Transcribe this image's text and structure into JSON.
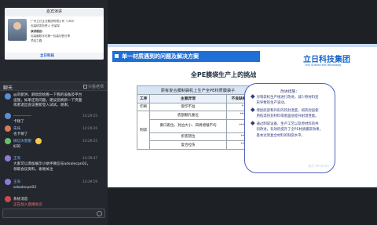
{
  "speaker": {
    "banner": "嘉宾演讲",
    "lines": [
      "广州立日企业集团有限公司（LRD）",
      "包装研发负责人 许留军",
      "演讲题目：",
      "包装膜数字化第一包装切割分享",
      "项目之路"
    ],
    "logo": "立日科技"
  },
  "chat": {
    "title": "聊天",
    "only_teacher": "只看老师",
    "messages": [
      {
        "name": "",
        "time": "",
        "text": [
          "@刘新洪、麻烦您给看一下我的设备及平台",
          "设施，如果还有问题，建议您刷新一下页面",
          "或者退出会议重新登入试试。谢谢。"
        ]
      },
      {
        "name": "一一一一一",
        "time": "14:29:25",
        "text": [
          "卡顿了"
        ]
      },
      {
        "name": "朱妹",
        "time": "14:29:26",
        "text": [
          "也卡顿了"
        ]
      },
      {
        "name": "微信天客服",
        "time": "14:29:25",
        "text": [
          "好的"
        ]
      },
      {
        "name": "王军",
        "time": "14:39:47",
        "text": [
          "大家可以添加展示小助手微信号adsalecpn02，",
          "领取会议资料，谢谢关注"
        ]
      },
      {
        "name": "王军",
        "time": "14:39:59",
        "text": [
          "adsalecpn02"
        ]
      },
      {
        "name": "系统消息",
        "time": "",
        "text": [
          "正在加入直播会议"
        ]
      }
    ],
    "input_placeholder": ""
  },
  "slide": {
    "heading": "单一材质遇到的问题及解决方案",
    "logo": "立日科技集团",
    "logo_sub": "Lirry Science and Technology",
    "subtitle": "全PE膜袋生产上的挑战",
    "table": {
      "caption": "原有复合膜制袋机上生产全PE材质膜袋子",
      "headers": [
        "工序",
        "主要异常",
        "不良缺陷占比"
      ],
      "rows": [
        [
          "印刷",
          "套印不准",
          "*"
        ],
        [
          "",
          "底部翻孔脆位",
          "***"
        ],
        [
          "制袋",
          "撕口跑位、封边大小、四周褶皱不均",
          "****"
        ],
        [
          "",
          "折底错位",
          "**"
        ],
        [
          "",
          "复合拉伤",
          "**"
        ]
      ]
    },
    "callout_title": "改进措施：",
    "bullets": [
      [
        "对制袋机生产线进行改进，减少原材料变",
        "形导致的生产波动。"
      ],
      [
        "增加底部和外形的热封温度，如热封层使",
        "用低温热封材料或者面层提升耐温性能。"
      ],
      [
        "通过制袋设备、生产工艺以及原材料的共",
        "同改进，有效的提升了全PE材质膜袋效果，",
        "基本达到复合材料的制袋水平。"
      ]
    ],
    "watermark": "激活 Windows"
  }
}
